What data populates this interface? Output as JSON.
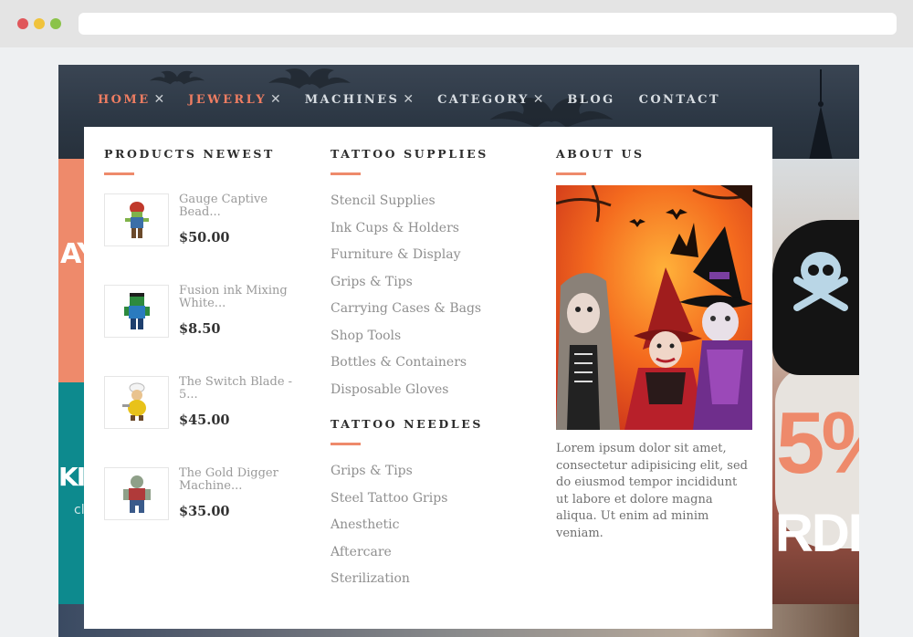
{
  "nav": {
    "items": [
      {
        "label": "HOME",
        "has_close": true,
        "active": true
      },
      {
        "label": "JEWERLY",
        "has_close": true,
        "active": true
      },
      {
        "label": "MACHINES",
        "has_close": true,
        "active": false
      },
      {
        "label": "CATEGORY",
        "has_close": true,
        "active": false
      },
      {
        "label": "BLOG",
        "has_close": false,
        "active": false
      },
      {
        "label": "CONTACT",
        "has_close": false,
        "active": false
      }
    ],
    "close_glyph": "✕"
  },
  "mega_menu": {
    "products_newest": {
      "heading": "PRODUCTS NEWEST",
      "items": [
        {
          "name": "Gauge Captive Bead...",
          "price": "$50.00"
        },
        {
          "name": "Fusion ink Mixing White...",
          "price": "$8.50"
        },
        {
          "name": "The Switch Blade - 5...",
          "price": "$45.00"
        },
        {
          "name": "The Gold Digger Machine...",
          "price": "$35.00"
        }
      ]
    },
    "tattoo_supplies": {
      "heading": "TATTOO SUPPLIES",
      "links": [
        "Stencil Supplies",
        "Ink Cups & Holders",
        "Furniture & Display",
        "Grips & Tips",
        "Carrying Cases & Bags",
        "Shop Tools",
        "Bottles & Containers",
        "Disposable Gloves"
      ]
    },
    "tattoo_needles": {
      "heading": "TATTOO NEEDLES",
      "links": [
        "Grips & Tips",
        "Steel Tattoo Grips",
        "Anesthetic",
        "Aftercare",
        "Sterilization"
      ]
    },
    "about_us": {
      "heading": "ABOUT US",
      "text": "Lorem ipsum dolor sit amet, consectetur adipisicing elit, sed do eiusmod tempor incididunt ut labore et dolore magna aliqua. Ut enim ad minim veniam."
    }
  },
  "background": {
    "left_text_1": "AY",
    "left_text_2": "KIN",
    "left_text_3": "cl",
    "right_big": "5%",
    "right_text": "RDE"
  },
  "colors": {
    "accent": "#ee7d62",
    "teal": "#0d8a8e",
    "dark_header": "#2c3744"
  }
}
